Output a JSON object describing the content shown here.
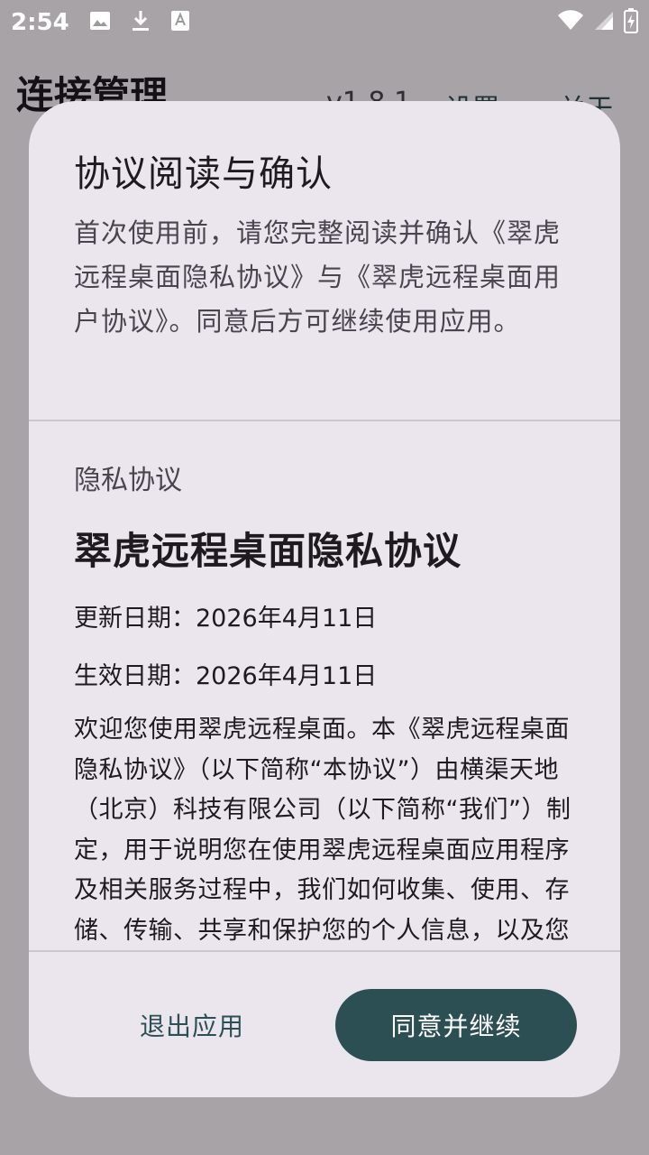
{
  "status_bar": {
    "time": "2:54",
    "icons": [
      "image-icon",
      "download-icon",
      "translate-icon",
      "wifi-icon",
      "signal-icon",
      "battery-charging-icon"
    ]
  },
  "app_bar": {
    "title": "连接管理",
    "version": "v1.8.1",
    "settings": "设置",
    "about": "关于"
  },
  "dialog": {
    "title": "协议阅读与确认",
    "intro": "首次使用前，请您完整阅读并确认《翠虎远程桌面隐私协议》与《翠虎远程桌面用户协议》。同意后方可继续使用应用。",
    "section_label": "隐私协议",
    "doc_title": "翠虎远程桌面隐私协议",
    "updated": "更新日期：2026年4月11日",
    "effective": "生效日期：2026年4月11日",
    "body": "欢迎您使用翠虎远程桌面。本《翠虎远程桌面隐私协议》（以下简称“本协议”）由横渠天地（北京）科技有限公司（以下简称“我们”）制定，用于说明您在使用翠虎远程桌面应用程序及相关服务过程中，我们如何收集、使用、存储、传输、共享和保护您的个人信息，以及您",
    "exit_button": "退出应用",
    "agree_button": "同意并继续"
  },
  "colors": {
    "dialog_bg": "#ebe5ee",
    "primary_button": "#2b4f53",
    "text_button": "#2c4f54",
    "scrim": "rgba(0,0,0,0.34)"
  }
}
